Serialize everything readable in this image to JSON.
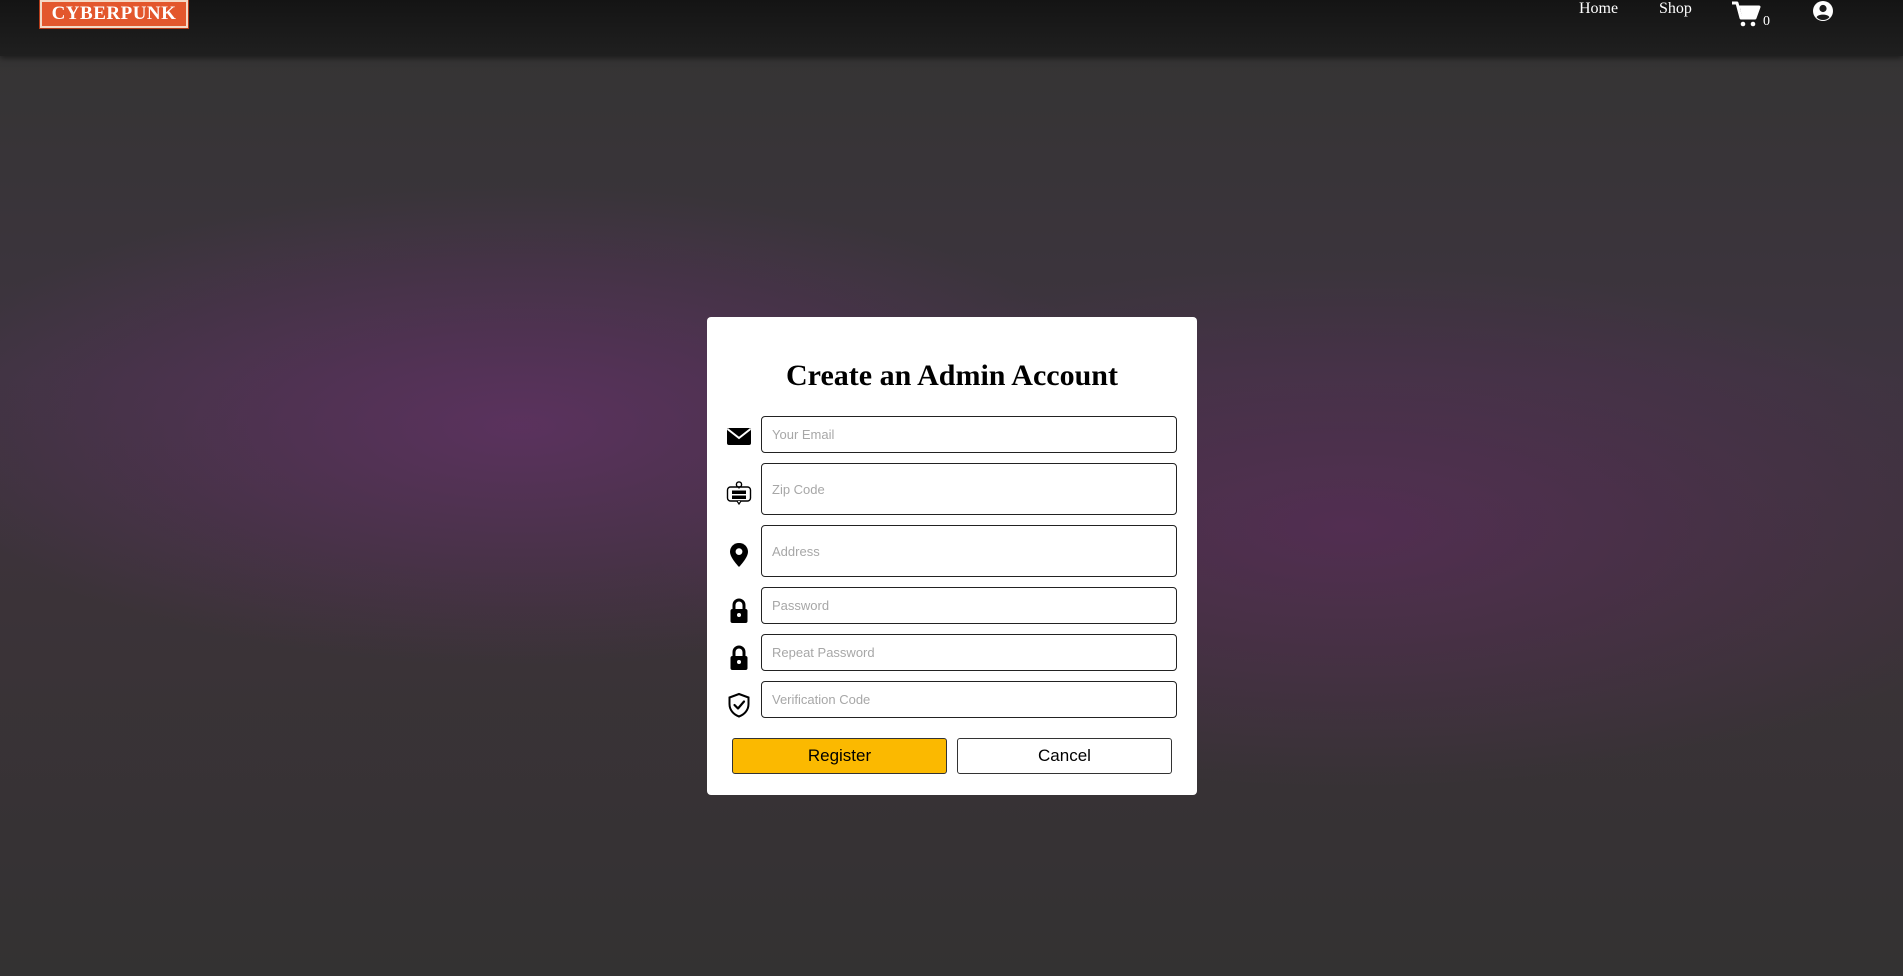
{
  "brand": {
    "logo_text": "CYBERPUNK",
    "accent": "#e3572d"
  },
  "nav": {
    "home_label": "Home",
    "shop_label": "Shop",
    "cart_count": "0",
    "icons": {
      "cart": "cart-icon",
      "user": "user-circle-icon"
    }
  },
  "form": {
    "title": "Create an Admin Account",
    "fields": [
      {
        "icon": "envelope-icon",
        "placeholder": "Your Email",
        "value": ""
      },
      {
        "icon": "zip-code-icon",
        "placeholder": "Zip Code",
        "value": ""
      },
      {
        "icon": "map-pin-icon",
        "placeholder": "Address",
        "value": ""
      },
      {
        "icon": "lock-icon",
        "placeholder": "Password",
        "value": ""
      },
      {
        "icon": "lock-icon",
        "placeholder": "Repeat Password",
        "value": ""
      },
      {
        "icon": "shield-check-icon",
        "placeholder": "Verification Code",
        "value": ""
      }
    ],
    "register_label": "Register",
    "cancel_label": "Cancel",
    "register_color": "#fbb900"
  }
}
